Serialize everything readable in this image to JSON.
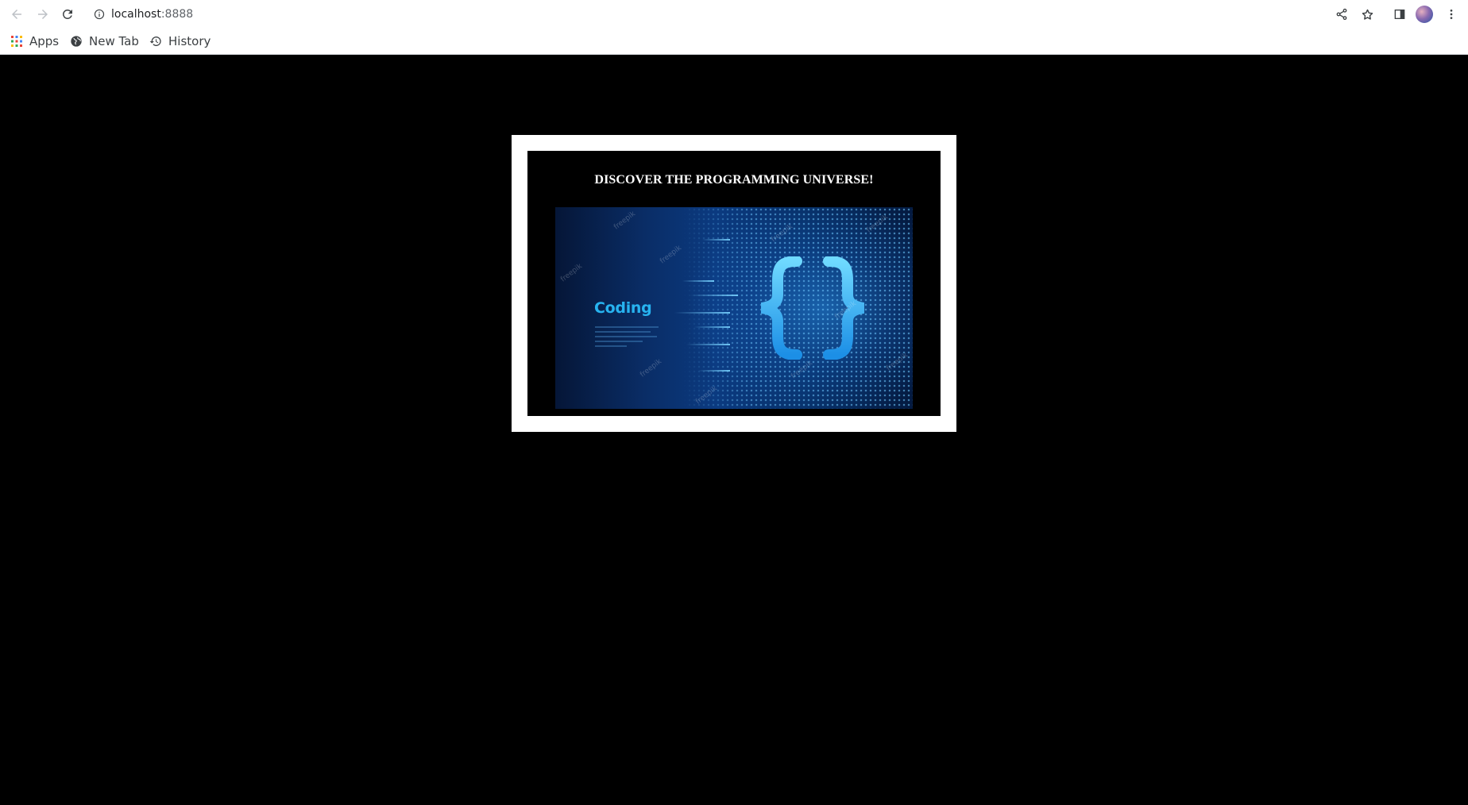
{
  "browser": {
    "url_host": "localhost",
    "url_port": ":8888",
    "bookmarks": [
      {
        "label": "Apps",
        "icon": "apps-grid-icon"
      },
      {
        "label": "New Tab",
        "icon": "globe-icon"
      },
      {
        "label": "History",
        "icon": "history-icon"
      }
    ]
  },
  "page": {
    "title": "DISCOVER THE PROGRAMMING UNIVERSE!",
    "hero_image": {
      "text": "Coding",
      "watermark": "freepik",
      "icon": "curly-braces-icon"
    }
  },
  "colors": {
    "page_background": "#000000",
    "frame": "#ffffff",
    "title_text": "#ffffff",
    "hero_accent": "#27b3f0"
  }
}
